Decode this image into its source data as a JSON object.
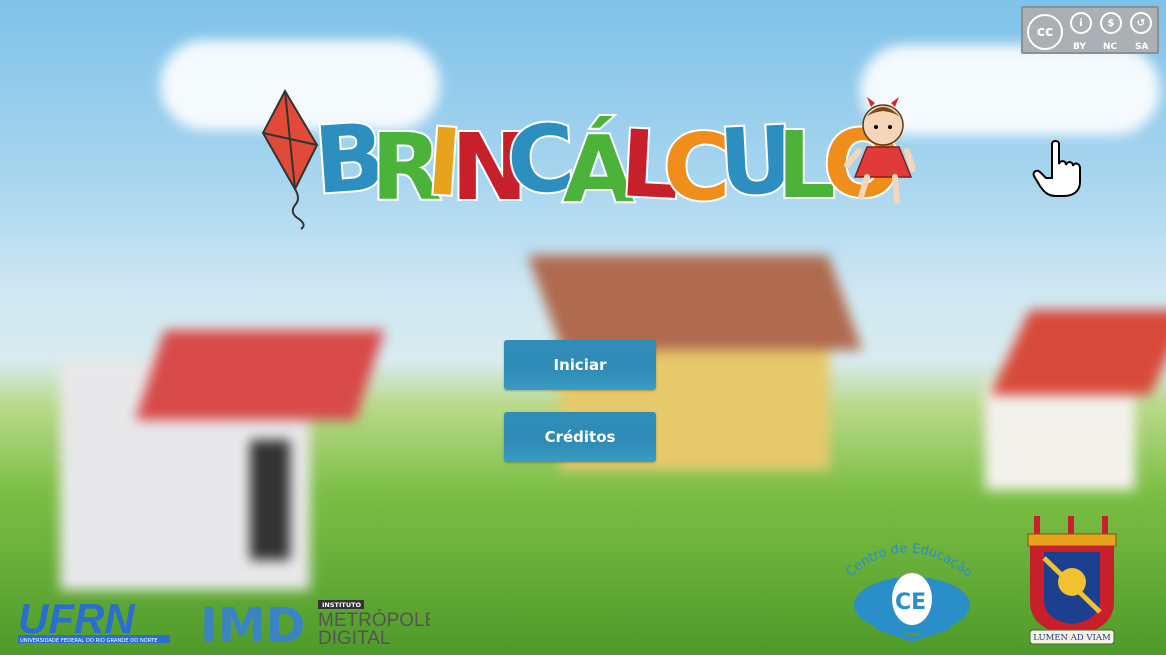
{
  "game": {
    "title_letters": [
      "B",
      "R",
      "I",
      "N",
      "C",
      "Á",
      "L",
      "C",
      "U",
      "L",
      "O"
    ],
    "title_colors": [
      "#2d8fbf",
      "#4cb33a",
      "#e7a21e",
      "#c8202a",
      "#2d8fbf",
      "#4cb33a",
      "#c8202a",
      "#ef8e1a",
      "#2d8fbf",
      "#4cb33a",
      "#ef8e1a"
    ]
  },
  "menu": {
    "start_label": "Iniciar",
    "credits_label": "Créditos"
  },
  "license": {
    "items": [
      "BY",
      "NC",
      "SA"
    ]
  },
  "logos": {
    "ufrn": "UFRN",
    "ufrn_sub": "UNIVERSIDADE FEDERAL DO RIO GRANDE DO NORTE",
    "imd": "IMD",
    "imd_badge": "INSTITUTO",
    "imd_line1": "METRÓPOLE",
    "imd_line2": "DIGITAL",
    "ce_text": "Centro de Educação",
    "ce_letters": "CE",
    "brasao_motto": "LUMEN AD VIAM"
  },
  "colors": {
    "button": "#2e8cb6",
    "accent_red": "#c8202a"
  },
  "icons": [
    "kite-icon",
    "doll-icon",
    "pointer-hand-icon",
    "cc-license-icon"
  ]
}
